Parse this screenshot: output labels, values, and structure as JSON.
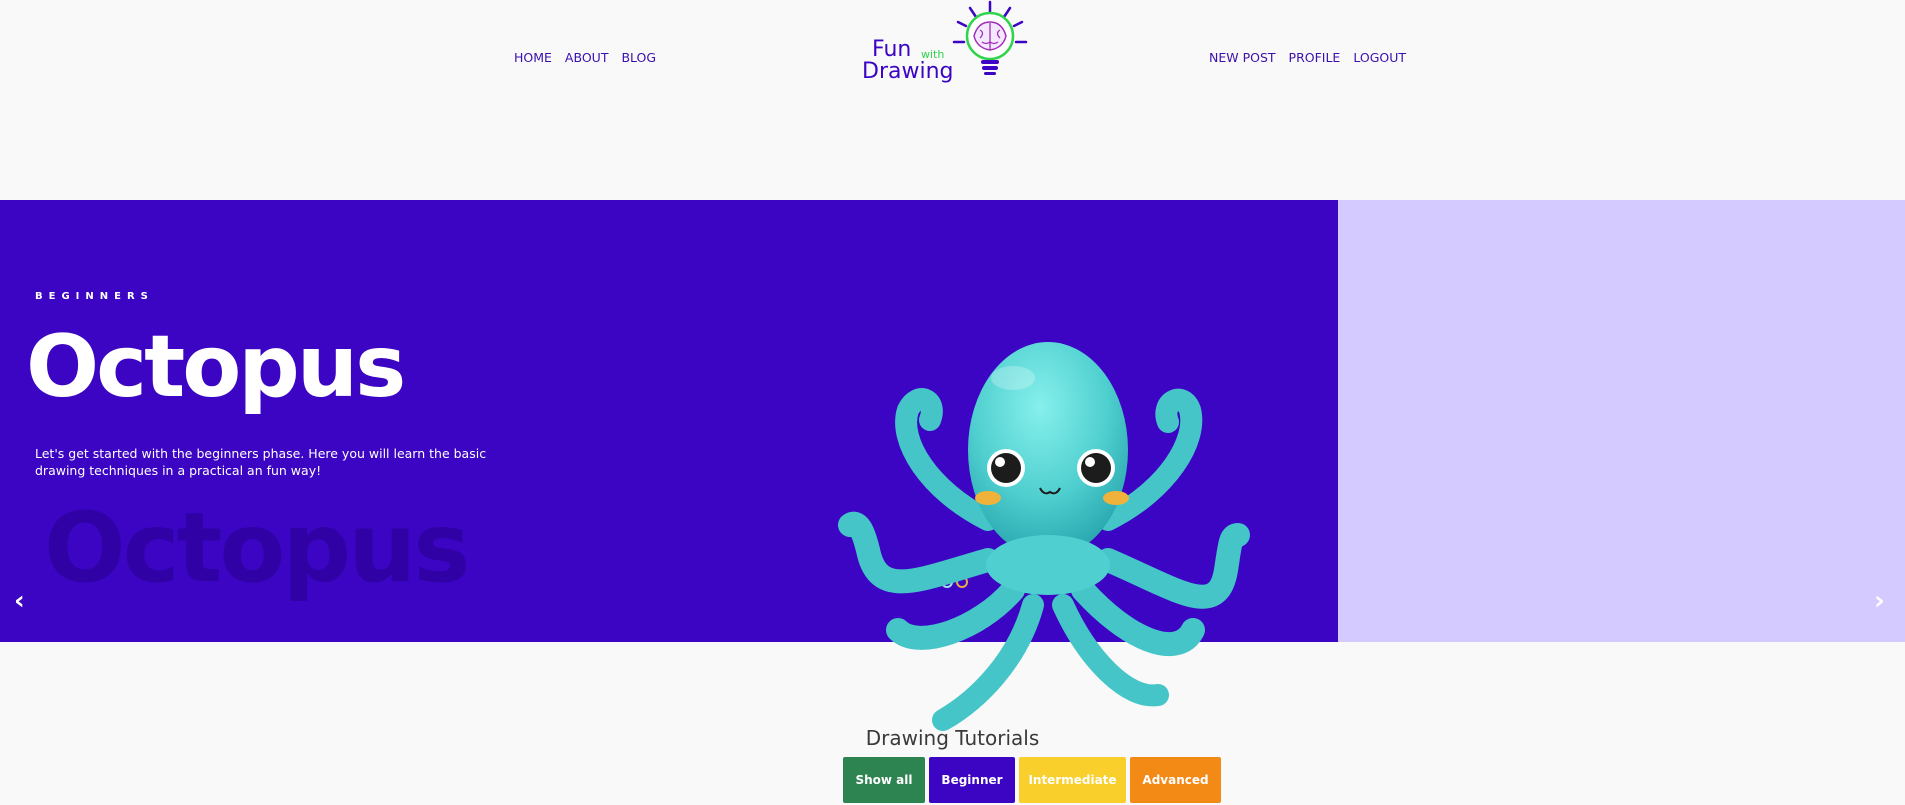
{
  "nav": {
    "left": [
      "HOME",
      "ABOUT",
      "BLOG"
    ],
    "right": [
      "NEW POST",
      "PROFILE",
      "LOGOUT"
    ]
  },
  "logo": {
    "line1": "Fun",
    "line1_small": "with",
    "line2": "Drawing",
    "icon": "brain-lightbulb-icon"
  },
  "hero": {
    "kicker": "BEGINNERS",
    "title": "Octopus",
    "ghost": "Octopus",
    "description": "Let's get started with the beginners phase. Here you will learn the basic drawing techniques in a practical an fun way!",
    "prev": "‹",
    "next": "›",
    "slide_count": 3,
    "active_slide": 1
  },
  "tutorials": {
    "title": "Drawing Tutorials",
    "filters": [
      {
        "label": "Show all",
        "color": "#2e8450"
      },
      {
        "label": "Beginner",
        "color": "#3b05c3"
      },
      {
        "label": "Intermediate",
        "color": "#f8cf2b"
      },
      {
        "label": "Advanced",
        "color": "#f48a16"
      }
    ]
  },
  "colors": {
    "brand_purple": "#3b05c3",
    "side_lavender": "#d5caff",
    "octopus": "#4fcfcf"
  }
}
